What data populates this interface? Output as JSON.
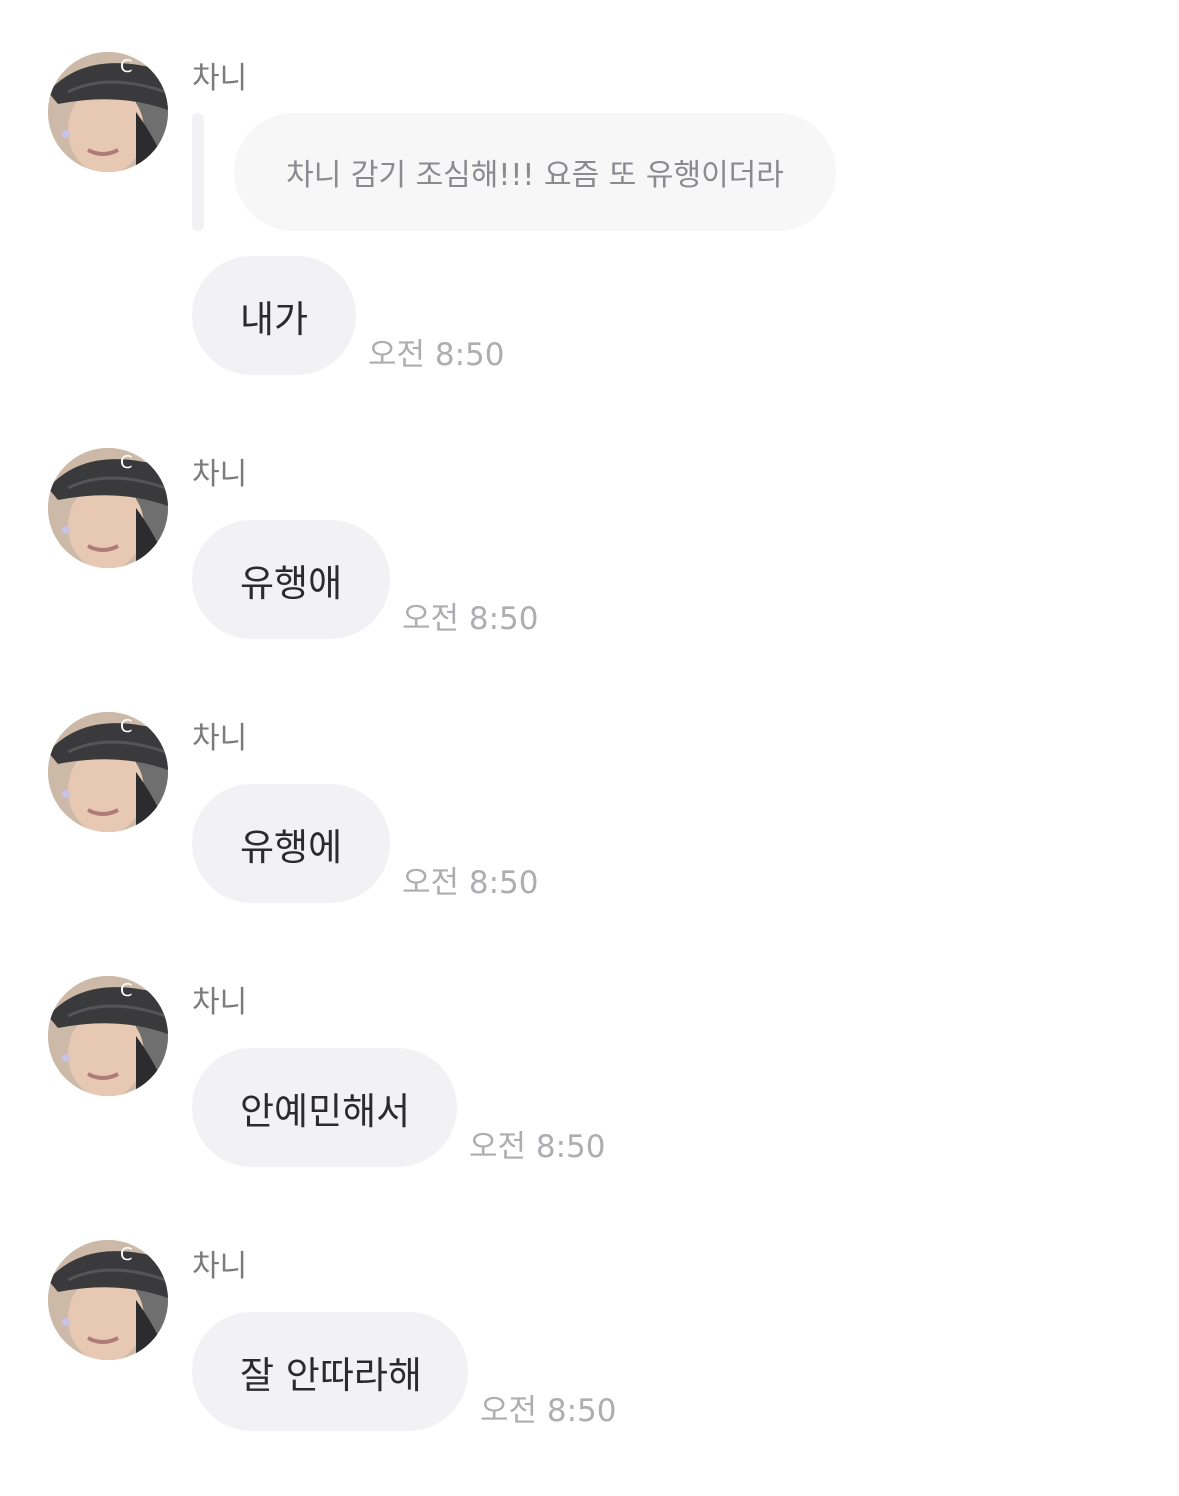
{
  "messages": [
    {
      "sender": "차니",
      "quote": "차니 감기 조심해!!! 요즘 또 유행이더라",
      "text": "내가",
      "time": "오전 8:50"
    },
    {
      "sender": "차니",
      "text": "유행애",
      "time": "오전 8:50"
    },
    {
      "sender": "차니",
      "text": "유행에",
      "time": "오전 8:50"
    },
    {
      "sender": "차니",
      "text": "안예민해서",
      "time": "오전 8:50"
    },
    {
      "sender": "차니",
      "text": "잘 안따라해",
      "time": "오전 8:50"
    }
  ],
  "colors": {
    "bubble": "#f2f2f4",
    "quote_bubble": "#f7f7f8",
    "sender_text": "#7a7a7f",
    "message_text": "#2b2b2e",
    "time_text": "#adadb2"
  },
  "icons": {
    "avatar": "profile-photo"
  }
}
